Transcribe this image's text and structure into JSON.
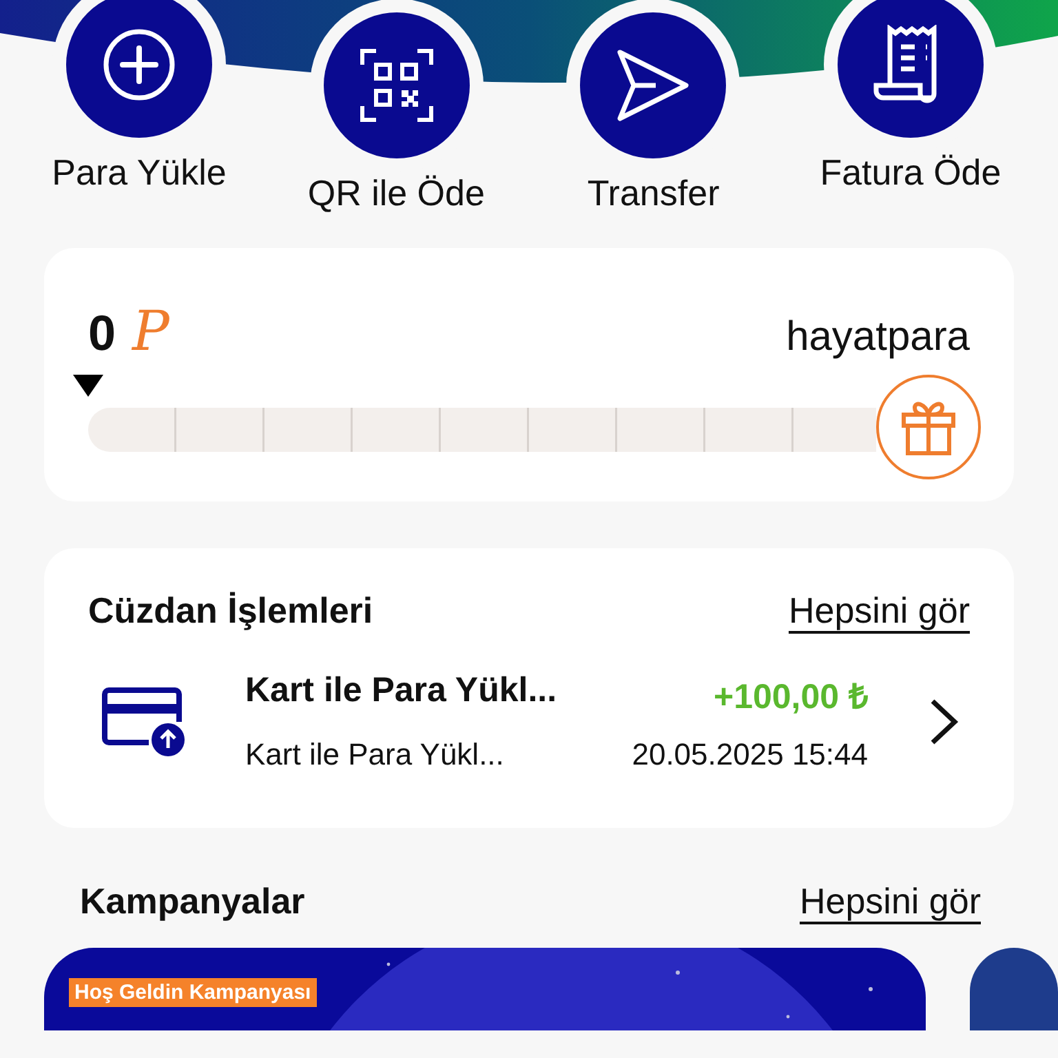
{
  "quick_actions": [
    {
      "label": "Para Yükle",
      "kind": "add"
    },
    {
      "label": "QR ile Öde",
      "kind": "qr"
    },
    {
      "label": "Transfer",
      "kind": "send"
    },
    {
      "label": "Fatura Öde",
      "kind": "bill"
    }
  ],
  "points": {
    "amount": "0",
    "symbol": "P",
    "brand": "hayatpara",
    "level": 0
  },
  "wallet": {
    "title": "Cüzdan İşlemleri",
    "see_all": "Hepsini gör",
    "transactions": [
      {
        "title": "Kart ile Para Yükl...",
        "subtitle": "Kart ile Para Yükl...",
        "amount": "+100,00 ₺",
        "datetime": "20.05.2025 15:44"
      }
    ]
  },
  "campaigns": {
    "title": "Kampanyalar",
    "see_all": "Hepsini gör",
    "items": [
      {
        "kind": "picture",
        "tag": "Hoş Geldin Kampanyası"
      },
      {
        "kind": "picture"
      }
    ]
  }
}
